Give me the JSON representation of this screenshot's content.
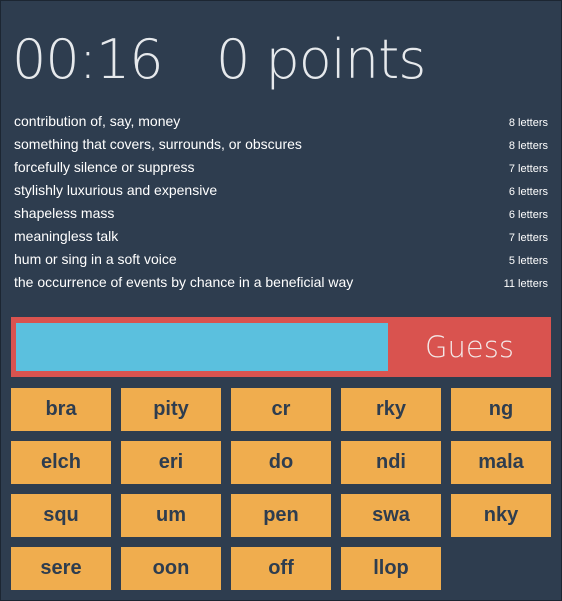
{
  "header": {
    "timer": "00:16",
    "score": "0 points"
  },
  "clues": [
    {
      "text": "contribution of, say, money",
      "length": "8 letters"
    },
    {
      "text": "something that covers, surrounds, or obscures",
      "length": "8 letters"
    },
    {
      "text": "forcefully silence or suppress",
      "length": "7 letters"
    },
    {
      "text": "stylishly luxurious and expensive",
      "length": "6 letters"
    },
    {
      "text": "shapeless mass",
      "length": "6 letters"
    },
    {
      "text": "meaningless talk",
      "length": "7 letters"
    },
    {
      "text": "hum or sing in a soft voice",
      "length": "5 letters"
    },
    {
      "text": "the occurrence of events by chance in a beneficial way",
      "length": "11 letters"
    }
  ],
  "guess": {
    "value": "",
    "button_label": "Guess"
  },
  "tiles": [
    "bra",
    "pity",
    "cr",
    "rky",
    "ng",
    "elch",
    "eri",
    "do",
    "ndi",
    "mala",
    "squ",
    "um",
    "pen",
    "swa",
    "nky",
    "sere",
    "oon",
    "off",
    "llop"
  ],
  "colors": {
    "background": "#2e3d4f",
    "input": "#5bc0de",
    "guess_bar": "#d9534f",
    "tile": "#f0ad4e",
    "tile_text": "#2e3d4f"
  }
}
